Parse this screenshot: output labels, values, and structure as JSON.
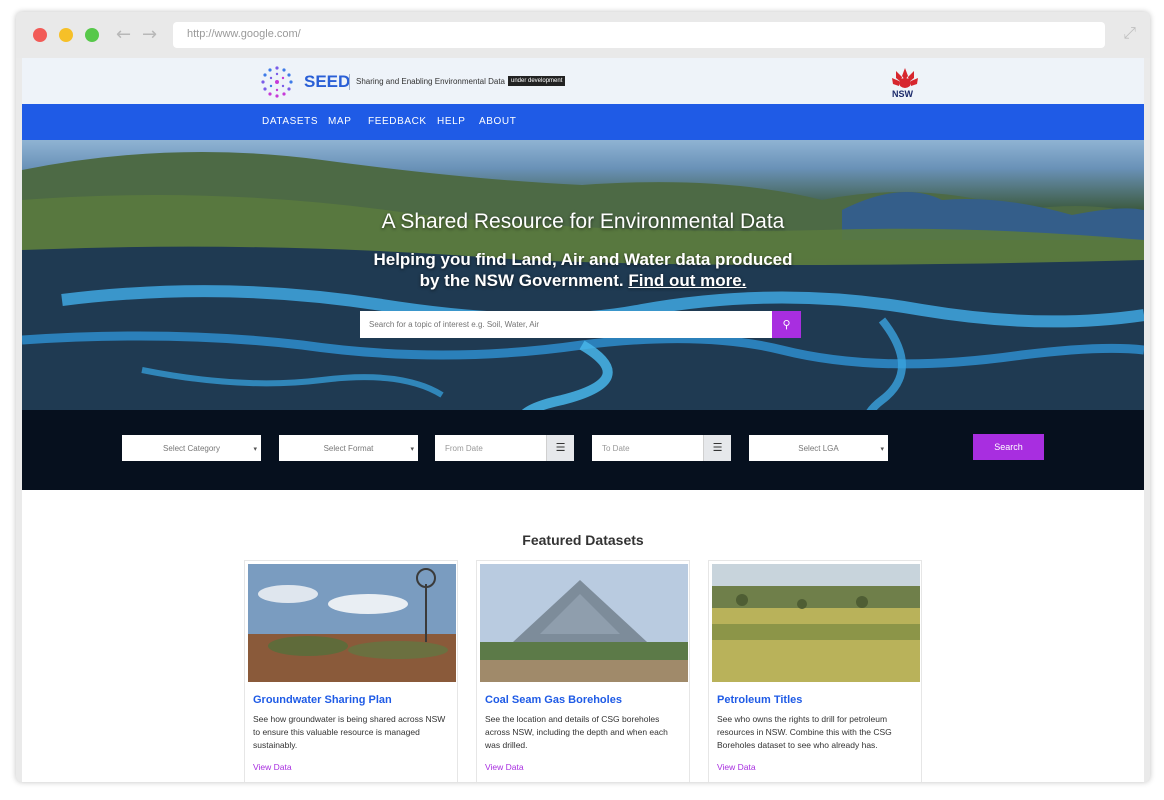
{
  "browser": {
    "url": "http://www.google.com/"
  },
  "header": {
    "brand": "SEED",
    "tagline": "Sharing and Enabling Environmental Data",
    "badge": "under development",
    "gov_logo_text": "NSW"
  },
  "nav": {
    "items": [
      "DATASETS",
      "MAP",
      "FEEDBACK",
      "HELP",
      "ABOUT"
    ]
  },
  "hero": {
    "title": "A Shared Resource for Environmental Data",
    "subtitle_line1": "Helping you find Land, Air and Water data produced",
    "subtitle_line2": "by the NSW Government.",
    "subtitle_link": "Find out more.",
    "search_placeholder": "Search for a topic of interest e.g. Soil, Water, Air"
  },
  "filters": {
    "category": "Select Category",
    "format": "Select Format",
    "from_date": "From Date",
    "to_date": "To Date",
    "lga": "Select LGA",
    "search_label": "Search"
  },
  "featured": {
    "title": "Featured Datasets",
    "cards": [
      {
        "title": "Groundwater Sharing Plan",
        "description": "See how groundwater is being shared across NSW to ensure this valuable resource is managed sustainably.",
        "link": "View Data"
      },
      {
        "title": "Coal Seam Gas Boreholes",
        "description": "See the location and details of CSG boreholes across NSW, including the depth and when each was drilled.",
        "link": "View Data"
      },
      {
        "title": "Petroleum Titles",
        "description": "See who owns the rights to drill for petroleum resources in NSW. Combine this with the CSG Boreholes dataset to see who already has.",
        "link": "View Data"
      }
    ]
  },
  "colors": {
    "nav_blue": "#1f5be6",
    "accent_purple": "#a82ee0",
    "topbar_bg": "#eef3f9"
  }
}
